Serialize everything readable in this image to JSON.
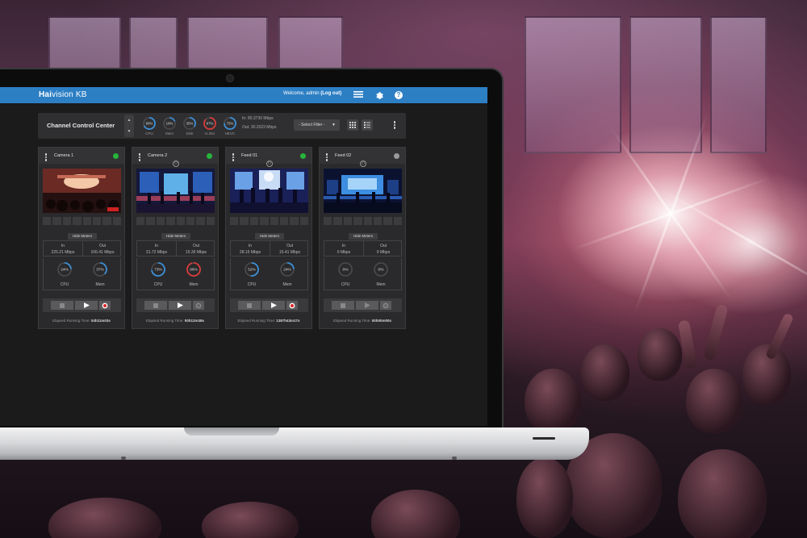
{
  "app": {
    "brand_prefix": "Hai",
    "brand_rest": "vision KB",
    "welcome": "Welcome, admin",
    "logout": "(Log out)"
  },
  "toolbar": {
    "title": "Channel Control Center",
    "in_rate": "In: 80.3730 Mbps",
    "out_rate": "Out: 30.2023 Mbps",
    "filter_placeholder": "- Select Filter -",
    "gauges": [
      {
        "label": "CPU",
        "value": "68%",
        "fraction": 0.68,
        "color": "#3b8fd6"
      },
      {
        "label": "Mem",
        "value": "19%",
        "fraction": 0.19,
        "color": "#3b8fd6"
      },
      {
        "label": "Disk",
        "value": "35%",
        "fraction": 0.35,
        "color": "#3b8fd6"
      },
      {
        "label": "H.264",
        "value": "87%",
        "fraction": 0.87,
        "color": "#d83b3b"
      },
      {
        "label": "HEVC",
        "value": "75%",
        "fraction": 0.75,
        "color": "#3b8fd6"
      }
    ]
  },
  "cards": [
    {
      "name": "Camera 1",
      "status_color": "#27b43a",
      "hide_meters": "Hide Meters",
      "in_label": "In",
      "in_value": "225.21 Mbps",
      "out_label": "Out",
      "out_value": "106.41 Mbps",
      "cpu_label": "CPU",
      "cpu_value": "24%",
      "cpu_fraction": 0.24,
      "cpu_color": "#3b8fd6",
      "mem_label": "Mem",
      "mem_value": "37%",
      "mem_fraction": 0.37,
      "mem_color": "#3b8fd6",
      "elapsed_label": "Elapsed Running Time:",
      "elapsed_value": "04h11m03s"
    },
    {
      "name": "Camera 2",
      "status_color": "#27b43a",
      "hide_meters": "Hide Meters",
      "in_label": "In",
      "in_value": "31.72 Mbps",
      "out_label": "Out",
      "out_value": "15.39 Mbps",
      "cpu_label": "CPU",
      "cpu_value": "73%",
      "cpu_fraction": 0.73,
      "cpu_color": "#3b8fd6",
      "mem_label": "Mem",
      "mem_value": "96%",
      "mem_fraction": 0.96,
      "mem_color": "#d83b3b",
      "elapsed_label": "Elapsed Running Time:",
      "elapsed_value": "00h12m38s"
    },
    {
      "name": "Feed 01",
      "status_color": "#27b43a",
      "hide_meters": "Hide Meters",
      "in_label": "In",
      "in_value": "28.15 Mbps",
      "out_label": "Out",
      "out_value": "15.41 Mbps",
      "cpu_label": "CPU",
      "cpu_value": "52%",
      "cpu_fraction": 0.52,
      "cpu_color": "#3b8fd6",
      "mem_label": "Mem",
      "mem_value": "24%",
      "mem_fraction": 0.24,
      "mem_color": "#3b8fd6",
      "elapsed_label": "Elapsed Running Time:",
      "elapsed_value": "1387h43m17s"
    },
    {
      "name": "Feed 02",
      "status_color": "#9a9a9a",
      "hide_meters": "Hide Meters",
      "in_label": "In",
      "in_value": "0 Mbps",
      "out_label": "Out",
      "out_value": "0 Mbps",
      "cpu_label": "CPU",
      "cpu_value": "0%",
      "cpu_fraction": 0,
      "cpu_color": "#3b8fd6",
      "mem_label": "Mem",
      "mem_value": "0%",
      "mem_fraction": 0,
      "mem_color": "#3b8fd6",
      "elapsed_label": "Elapsed Running Time:",
      "elapsed_value": "00h00m00s"
    }
  ]
}
